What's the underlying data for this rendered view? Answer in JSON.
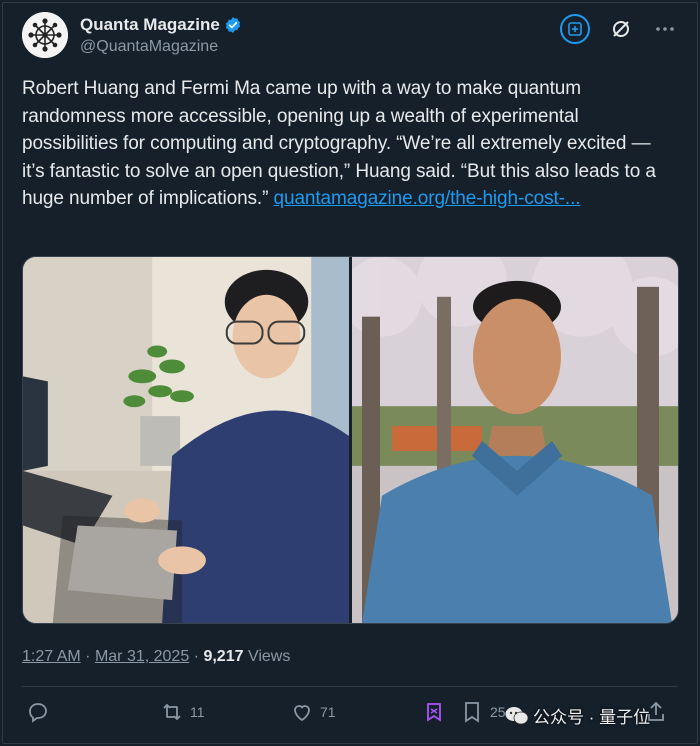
{
  "account": {
    "display_name": "Quanta Magazine",
    "handle": "@QuantaMagazine",
    "verified": true
  },
  "tweet": {
    "text": "Robert Huang and Fermi Ma came up with a way to make quantum randomness more accessible, opening up a wealth of experimental possibilities for computing and cryptography. “We’re all extremely excited — it’s fantastic to solve an open question,” Huang said. “But this also leads to a huge number of implications.” ",
    "link_text": "quantamagazine.org/the-high-cost-..."
  },
  "media": {
    "photos": [
      {
        "name": "photo-robert-huang"
      },
      {
        "name": "photo-fermi-ma"
      }
    ]
  },
  "meta": {
    "time": "1:27 AM",
    "separator": "·",
    "date": "Mar 31, 2025",
    "views_count": "9,217",
    "views_label": "Views"
  },
  "actions": {
    "reply": {
      "icon": "reply-icon",
      "count": ""
    },
    "repost": {
      "icon": "repost-icon",
      "count": "11"
    },
    "like": {
      "icon": "heart-icon",
      "count": "71"
    },
    "bookmark_count": "25"
  },
  "watermark": {
    "text": "公众号 · 量子位"
  },
  "colors": {
    "background": "#15202b",
    "accent": "#1d9bf0",
    "text": "#e7e9ea",
    "muted": "#8b98a5"
  }
}
